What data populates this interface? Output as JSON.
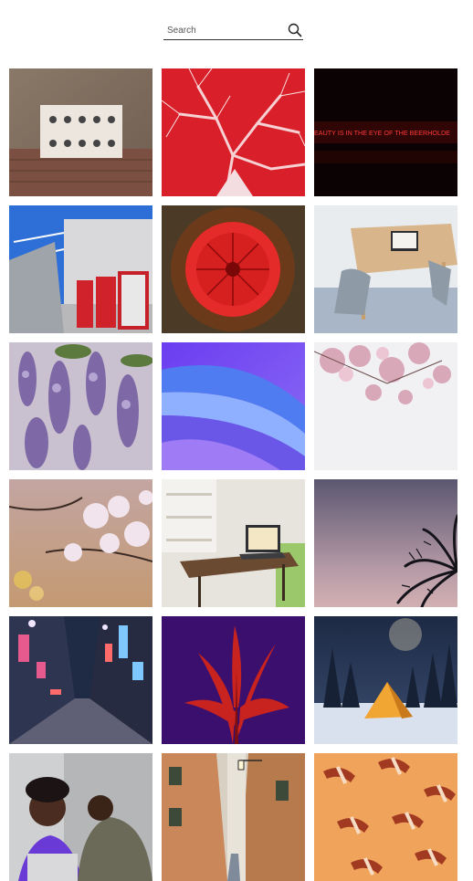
{
  "search": {
    "placeholder": "Search",
    "value": ""
  },
  "photos": [
    {
      "label": "Wall with round door knobs",
      "icon": "photo"
    },
    {
      "label": "Red tree silhouette",
      "icon": "photo"
    },
    {
      "label": "Red neon sign",
      "icon": "photo",
      "caption": "EAUTY IS IN THE EYE OF THE BEERHOLDE"
    },
    {
      "label": "Vending machines on Japanese street",
      "icon": "photo"
    },
    {
      "label": "Red radial flower pattern",
      "icon": "photo"
    },
    {
      "label": "Wooden table with laptop and chair",
      "icon": "photo"
    },
    {
      "label": "Purple wisteria flowers",
      "icon": "photo"
    },
    {
      "label": "Blue purple abstract waves",
      "icon": "photo"
    },
    {
      "label": "Pink cherry blossoms on white",
      "icon": "photo"
    },
    {
      "label": "Cherry blossoms with bokeh",
      "icon": "photo"
    },
    {
      "label": "Home office desk with laptop",
      "icon": "photo"
    },
    {
      "label": "Palm silhouette at dusk",
      "icon": "photo"
    },
    {
      "label": "Tokyo alley at night",
      "icon": "photo"
    },
    {
      "label": "Red leaves on purple",
      "icon": "photo"
    },
    {
      "label": "Tent in snowy forest",
      "icon": "photo"
    },
    {
      "label": "Couple with laptop",
      "icon": "photo"
    },
    {
      "label": "Narrow European alley",
      "icon": "photo"
    },
    {
      "label": "Red shapes pattern on orange",
      "icon": "photo"
    }
  ]
}
